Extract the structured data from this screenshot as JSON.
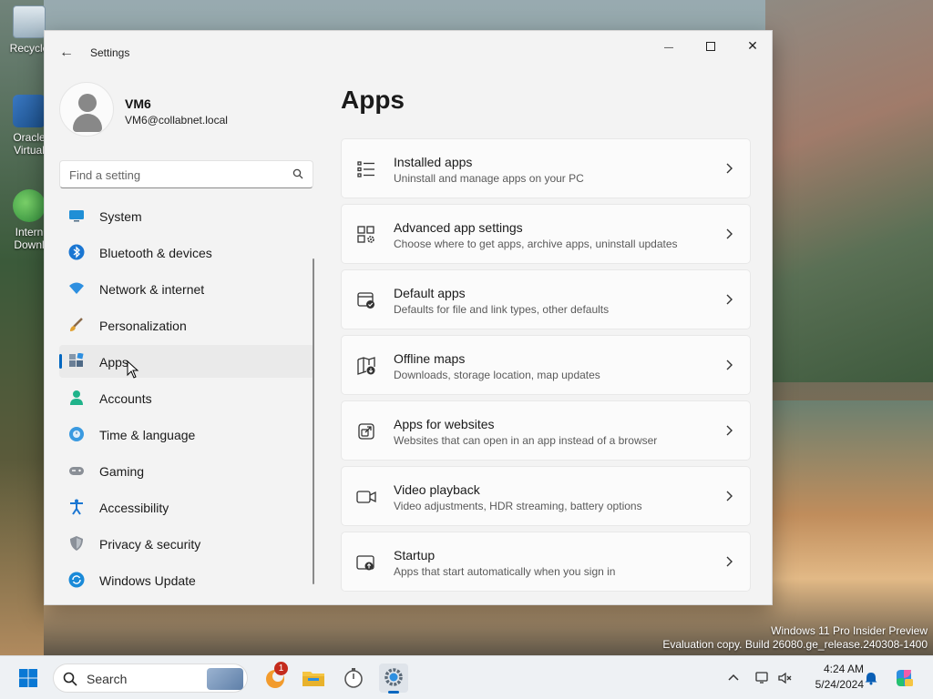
{
  "desktop": {
    "icons": [
      {
        "label": "Recycle"
      },
      {
        "label": "Oracle Virtual"
      },
      {
        "label": "Intern Downl"
      }
    ],
    "watermark_line1": "Windows 11 Pro Insider Preview",
    "watermark_line2": "Evaluation copy. Build 26080.ge_release.240308-1400"
  },
  "window": {
    "title": "Settings",
    "back_glyph": "←",
    "minimize_glyph": "—",
    "close_glyph": "✕"
  },
  "profile": {
    "name": "VM6",
    "email": "VM6@collabnet.local"
  },
  "search": {
    "placeholder": "Find a setting"
  },
  "nav": {
    "items": [
      {
        "label": "System",
        "icon": "monitor-icon",
        "active": false
      },
      {
        "label": "Bluetooth & devices",
        "icon": "bluetooth-icon",
        "active": false
      },
      {
        "label": "Network & internet",
        "icon": "wifi-icon",
        "active": false
      },
      {
        "label": "Personalization",
        "icon": "brush-icon",
        "active": false
      },
      {
        "label": "Apps",
        "icon": "apps-icon",
        "active": true
      },
      {
        "label": "Accounts",
        "icon": "person-icon",
        "active": false
      },
      {
        "label": "Time & language",
        "icon": "globe-clock-icon",
        "active": false
      },
      {
        "label": "Gaming",
        "icon": "gamepad-icon",
        "active": false
      },
      {
        "label": "Accessibility",
        "icon": "accessibility-icon",
        "active": false
      },
      {
        "label": "Privacy & security",
        "icon": "shield-icon",
        "active": false
      },
      {
        "label": "Windows Update",
        "icon": "update-icon",
        "active": false
      }
    ]
  },
  "main": {
    "title": "Apps",
    "cards": [
      {
        "title": "Installed apps",
        "desc": "Uninstall and manage apps on your PC",
        "icon": "list-icon"
      },
      {
        "title": "Advanced app settings",
        "desc": "Choose where to get apps, archive apps, uninstall updates",
        "icon": "apps-gear-icon"
      },
      {
        "title": "Default apps",
        "desc": "Defaults for file and link types, other defaults",
        "icon": "default-apps-icon"
      },
      {
        "title": "Offline maps",
        "desc": "Downloads, storage location, map updates",
        "icon": "map-download-icon"
      },
      {
        "title": "Apps for websites",
        "desc": "Websites that can open in an app instead of a browser",
        "icon": "open-external-icon"
      },
      {
        "title": "Video playback",
        "desc": "Video adjustments, HDR streaming, battery options",
        "icon": "video-camera-icon"
      },
      {
        "title": "Startup",
        "desc": "Apps that start automatically when you sign in",
        "icon": "startup-icon"
      }
    ]
  },
  "taskbar": {
    "search_label": "Search",
    "notification_count": "1",
    "time": "4:24 AM",
    "date": "5/24/2024",
    "chevron_glyph": "^"
  },
  "colors": {
    "accent": "#0067c0",
    "window_bg": "#f3f3f3",
    "card_bg": "#fbfbfb",
    "badge": "#c42b1c"
  }
}
